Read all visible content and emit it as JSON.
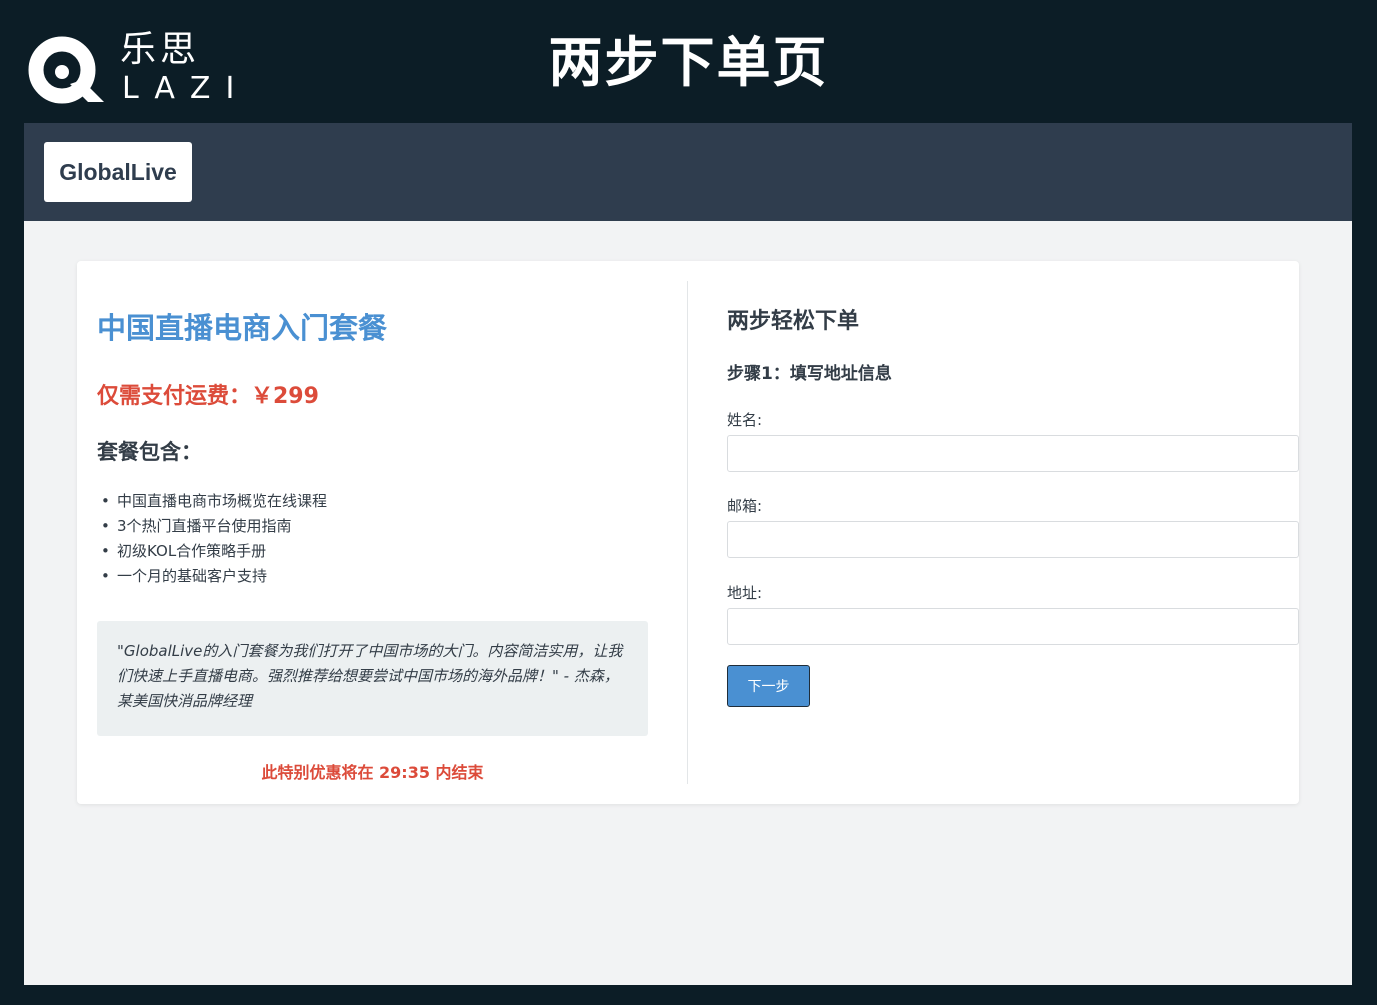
{
  "banner": {
    "logo_cn": "乐思",
    "logo_en": "LAZI",
    "title": "两步下单页"
  },
  "topbar": {
    "brand": "GlobalLive"
  },
  "package": {
    "title": "中国直播电商入门套餐",
    "price": "仅需支付运费：￥299",
    "includes_heading": "套餐包含：",
    "features": [
      "中国直播电商市场概览在线课程",
      "3个热门直播平台使用指南",
      "初级KOL合作策略手册",
      "一个月的基础客户支持"
    ],
    "testimonial": "\"GlobalLive的入门套餐为我们打开了中国市场的大门。内容简洁实用，让我们快速上手直播电商。强烈推荐给想要尝试中国市场的海外品牌！\" - 杰森，某美国快消品牌经理",
    "countdown": "此特别优惠将在 29:35 内结束"
  },
  "form": {
    "title": "两步轻松下单",
    "step_title": "步骤1：填写地址信息",
    "fields": [
      {
        "label": "姓名:",
        "value": "",
        "placeholder": ""
      },
      {
        "label": "邮箱:",
        "value": "",
        "placeholder": ""
      },
      {
        "label": "地址:",
        "value": "",
        "placeholder": ""
      }
    ],
    "next_button": "下一步"
  },
  "colors": {
    "banner_bg": "#0c1d26",
    "topbar_bg": "#2f3d4e",
    "accent_blue": "#4a90d2",
    "accent_red": "#dc4b3a",
    "page_bg": "#f2f3f4"
  }
}
